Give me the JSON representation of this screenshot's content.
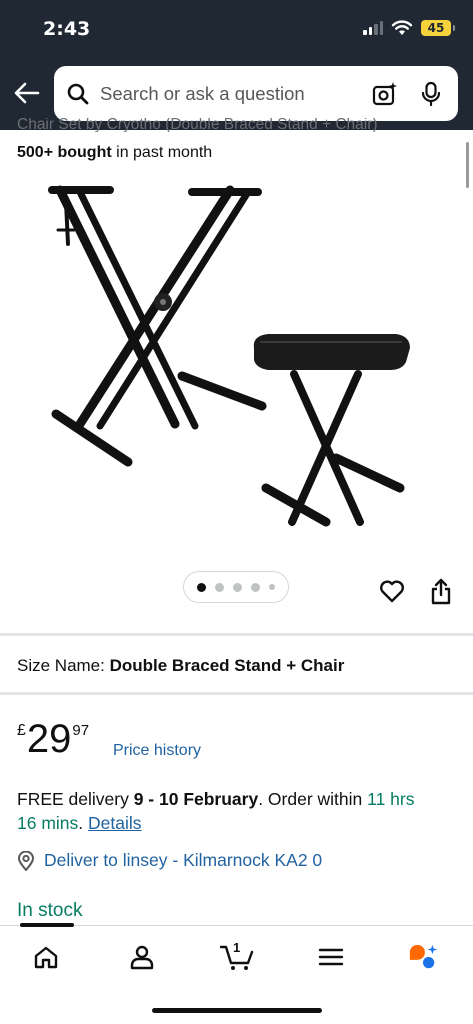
{
  "status_bar": {
    "time": "2:43",
    "battery": "45"
  },
  "search": {
    "placeholder": "Search or ask a question"
  },
  "product": {
    "truncated_title": "Chair Set by Cryotho   (Double Braced Stand + Chair)",
    "bought_bold": "500+ bought",
    "bought_rest": " in past month",
    "size_label": "Size Name: ",
    "size_value": "Double Braced Stand + Chair",
    "price_currency": "£",
    "price_whole": "29",
    "price_fraction": "97",
    "price_history": "Price history",
    "delivery_free": "FREE delivery ",
    "delivery_dates": "9 - 10 February",
    "delivery_order": ". Order within ",
    "delivery_countdown": "11 hrs 16 mins",
    "delivery_period": ". ",
    "details_link": "Details",
    "deliver_to": "Deliver to linsey - Kilmarnock KA2 0",
    "stock": "In stock"
  },
  "gallery": {
    "image_count": 5,
    "active_index": 0
  },
  "bottom_nav": {
    "cart_count": "1"
  },
  "colors": {
    "header_bg": "#1f2833",
    "link": "#2162a1",
    "stock_green": "#067d62",
    "rufus_orange": "#ff6a00",
    "rufus_blue": "#1a73e8"
  }
}
